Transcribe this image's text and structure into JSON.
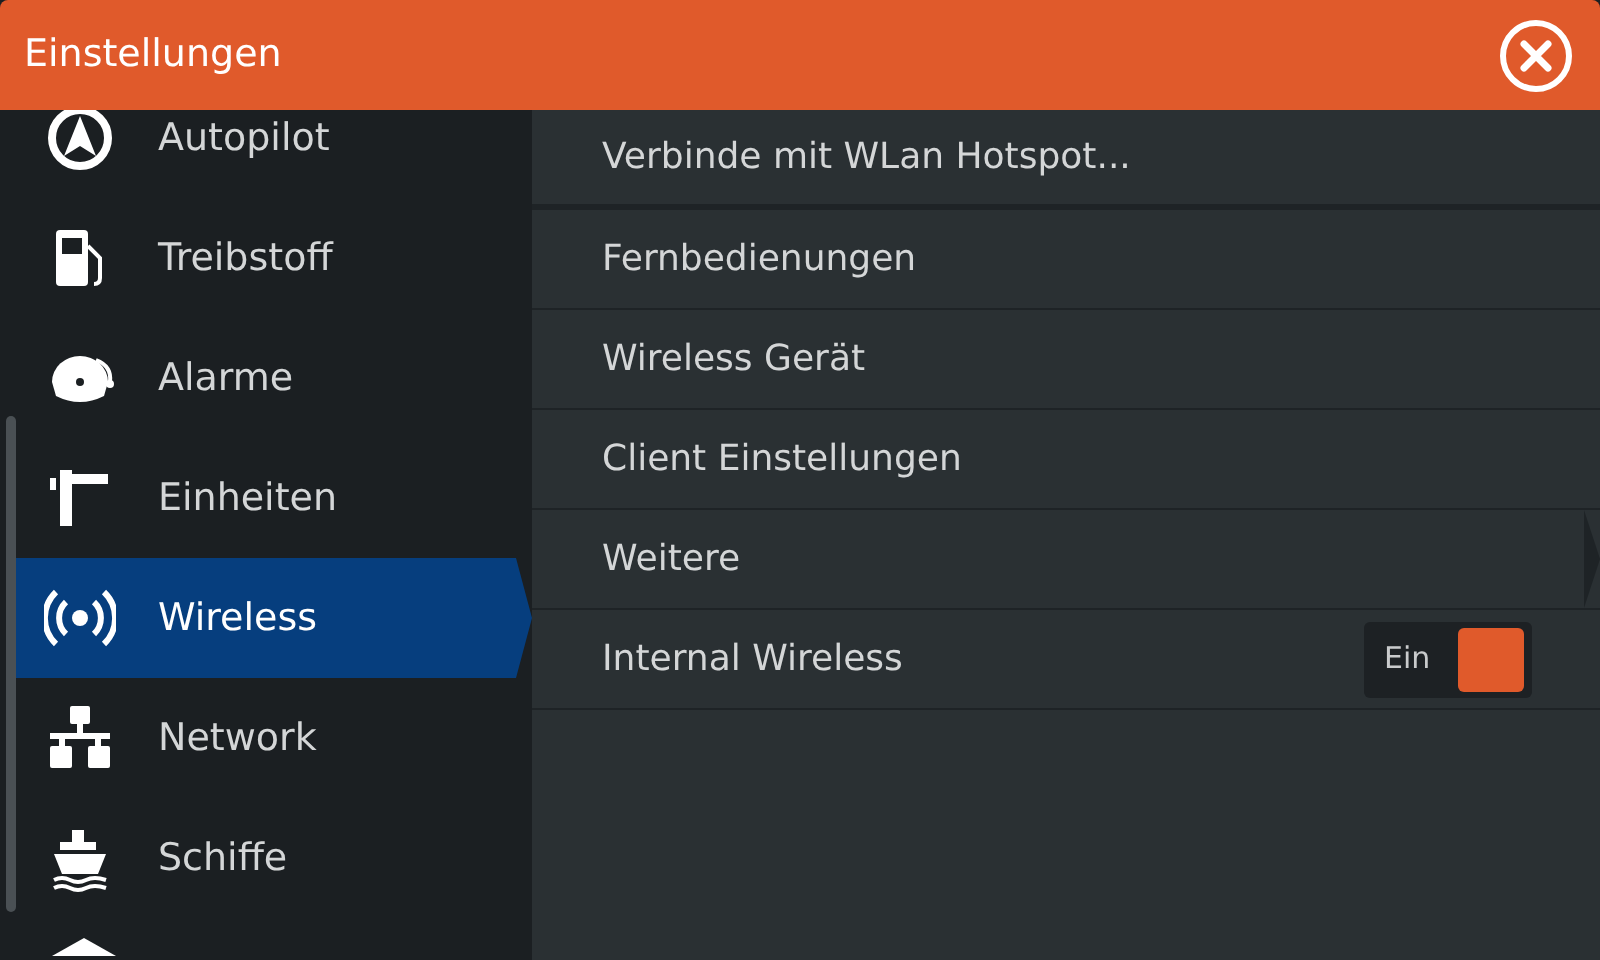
{
  "header": {
    "title": "Einstellungen"
  },
  "sidebar": {
    "items": [
      {
        "label": "Autopilot",
        "selected": false
      },
      {
        "label": "Treibstoff",
        "selected": false
      },
      {
        "label": "Alarme",
        "selected": false
      },
      {
        "label": "Einheiten",
        "selected": false
      },
      {
        "label": "Wireless",
        "selected": true
      },
      {
        "label": "Network",
        "selected": false
      },
      {
        "label": "Schiffe",
        "selected": false
      }
    ]
  },
  "panel": {
    "rows": [
      {
        "kind": "action",
        "label": "Verbinde mit WLan Hotspot..."
      },
      {
        "kind": "action",
        "label": "Fernbedienungen"
      },
      {
        "kind": "action",
        "label": "Wireless Gerät"
      },
      {
        "kind": "action",
        "label": "Client Einstellungen"
      },
      {
        "kind": "submenu",
        "label": "Weitere"
      },
      {
        "kind": "toggle",
        "label": "Internal Wireless",
        "toggle_label": "Ein",
        "on": true
      }
    ]
  }
}
